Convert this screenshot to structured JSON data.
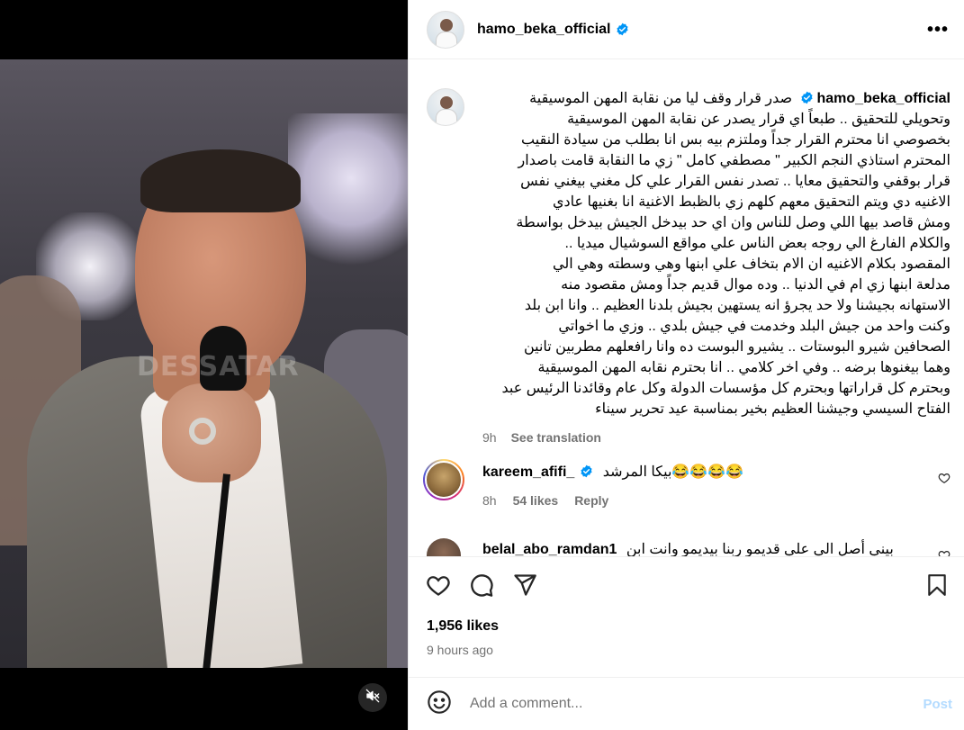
{
  "post": {
    "username": "hamo_beka_official",
    "video_watermark": "DESSATAR",
    "caption": {
      "username": "hamo_beka_official",
      "text": "صدر قرار وقف ليا من نقابة المهن الموسيقية\nوتحويلي للتحقيق .. طبعاً اي قرار يصدر عن نقابة المهن الموسيقية\nبخصوصي انا محترم القرار جداً وملتزم بيه بس انا بطلب من سيادة النقيب\nالمحترم استاذي النجم الكبير \" مصطفي كامل \" زي ما النقابة قامت باصدار\nقرار بوقفي والتحقيق معايا .. تصدر نفس القرار علي كل مغني بيغني نفس\nالاغنيه دي ويتم التحقيق معهم كلهم زي بالظبط الاغنية انا بغنيها عادي\nومش قاصد بيها اللي وصل للناس وان اي حد بيدخل الجيش بيدخل بواسطة\nوالكلام الفارغ الي روجه بعض الناس علي مواقع السوشيال ميديا ..\nالمقصود بكلام الاغنيه ان الام بتخاف علي ابنها وهي وسطته وهي الي\nمدلعة ابنها زي ام في الدنيا .. وده موال قديم جداً ومش مقصود منه\nالاستهانه بجيشنا ولا حد يجرؤ انه يستهين بجيش بلدنا العظيم .. وانا ابن بلد\nوكنت واحد من جيش البلد وخدمت في جيش بلدي .. وزي ما اخواتي\nالصحافين شيرو البوستات .. يشيرو البوست ده وانا رافعلهم مطربين تانين\nوهما بيغنوها برضه .. وفي اخر كلامي .. انا بحترم نقابه المهن الموسيقية\nوبحترم كل قراراتها وبحترم كل مؤسسات الدولة وكل عام وقائدنا الرئيس عبد\nالفتاح السيسي وجيشنا العظيم بخير بمناسبة عيد تحرير سيناء",
      "age": "9h",
      "see_translation": "See translation"
    },
    "comments": [
      {
        "username": "kareem_afifi_",
        "text": "بيكا المرشد😂😂😂😂",
        "age": "8h",
        "likes": "54 likes",
        "reply": "Reply"
      },
      {
        "username": "belal_abo_ramdan1",
        "text": "بيني أصل الي علي قديمو ربنا بيديمو وانت ابن"
      }
    ],
    "likes_count": "1,956 likes",
    "time_ago": "9 hours ago",
    "add_comment": {
      "placeholder": "Add a comment...",
      "post_label": "Post"
    }
  },
  "colors": {
    "verified_blue": "#0095f6",
    "secondary_text": "#737373",
    "post_disabled": "#b3dbff"
  }
}
